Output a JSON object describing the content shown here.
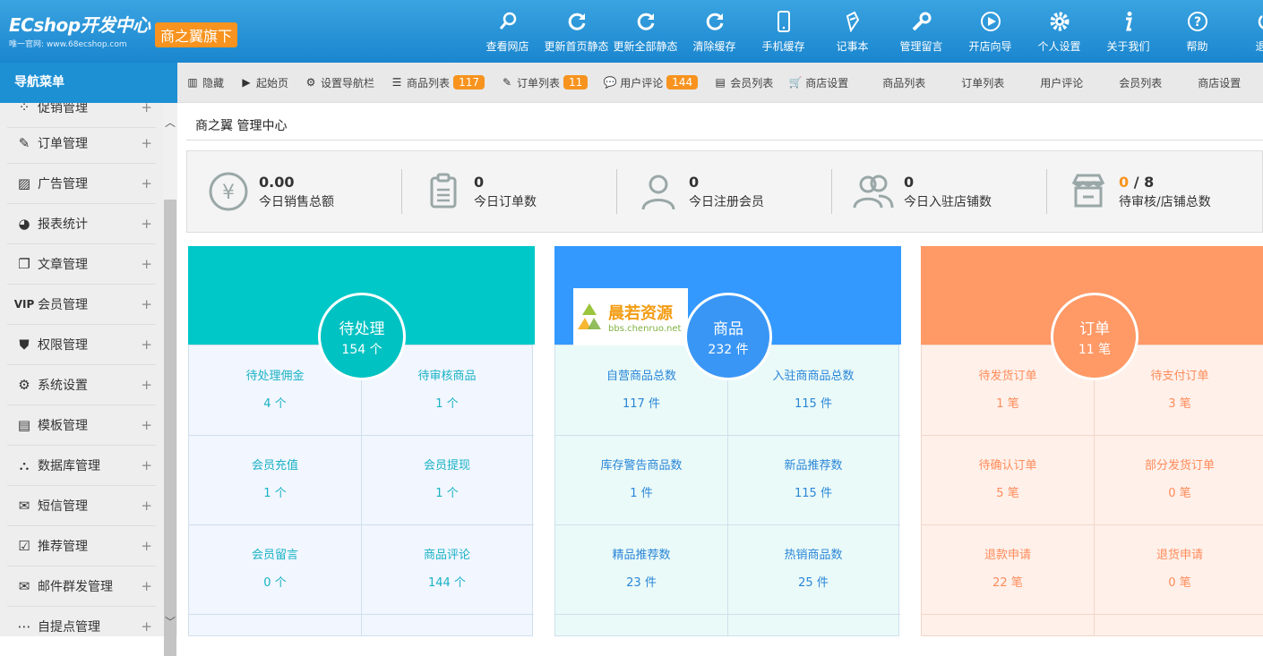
{
  "header": {
    "logo_text": "ECshop开发中心",
    "logo_sub": "唯一官网: www.68ecshop.com",
    "brand_badge": "商之翼旗下",
    "nav": [
      {
        "label": "查看网店",
        "icon": "search-icon"
      },
      {
        "label": "更新首页静态",
        "icon": "refresh-icon"
      },
      {
        "label": "更新全部静态",
        "icon": "refresh-icon"
      },
      {
        "label": "清除缓存",
        "icon": "refresh-icon"
      },
      {
        "label": "手机缓存",
        "icon": "phone-icon"
      },
      {
        "label": "记事本",
        "icon": "notebook-icon"
      },
      {
        "label": "管理留言",
        "icon": "wrench-icon"
      },
      {
        "label": "开店向导",
        "icon": "play-icon"
      },
      {
        "label": "个人设置",
        "icon": "gear-icon"
      },
      {
        "label": "关于我们",
        "icon": "info-icon"
      },
      {
        "label": "帮助",
        "icon": "help-icon"
      },
      {
        "label": "退出",
        "icon": "power-icon"
      }
    ]
  },
  "sidebar": {
    "title": "导航菜单",
    "items": [
      {
        "label": "促销管理",
        "icon": "promo-icon"
      },
      {
        "label": "订单管理",
        "icon": "order-icon"
      },
      {
        "label": "广告管理",
        "icon": "image-icon"
      },
      {
        "label": "报表统计",
        "icon": "pie-chart-icon"
      },
      {
        "label": "文章管理",
        "icon": "copy-icon"
      },
      {
        "label": "会员管理",
        "icon": "vip-icon"
      },
      {
        "label": "权限管理",
        "icon": "shield-icon"
      },
      {
        "label": "系统设置",
        "icon": "gears-icon"
      },
      {
        "label": "模板管理",
        "icon": "template-icon"
      },
      {
        "label": "数据库管理",
        "icon": "sitemap-icon"
      },
      {
        "label": "短信管理",
        "icon": "sms-icon"
      },
      {
        "label": "推荐管理",
        "icon": "checkbox-icon"
      },
      {
        "label": "邮件群发管理",
        "icon": "mail-icon"
      },
      {
        "label": "自提点管理",
        "icon": "more-icon"
      }
    ],
    "expand_symbol": "+"
  },
  "tabs": [
    {
      "label": "隐藏",
      "icon": "columns-icon"
    },
    {
      "label": "起始页",
      "icon": "play-circle-icon"
    },
    {
      "label": "设置导航栏",
      "icon": "settings-icon"
    },
    {
      "label": "商品列表",
      "icon": "list-icon",
      "badge": "117"
    },
    {
      "label": "订单列表",
      "icon": "order-list-icon",
      "badge": "11"
    },
    {
      "label": "用户评论",
      "icon": "comment-icon",
      "badge": "144"
    },
    {
      "label": "会员列表",
      "icon": "member-icon"
    },
    {
      "label": "商店设置",
      "icon": "shop-icon"
    }
  ],
  "plain_tabs": [
    "商品列表",
    "订单列表",
    "用户评论",
    "会员列表",
    "商店设置"
  ],
  "breadcrumb": "商之翼 管理中心",
  "stats": [
    {
      "value": "0.00",
      "label": "今日销售总额",
      "icon": "yen-icon"
    },
    {
      "value": "0",
      "label": "今日订单数",
      "icon": "clipboard-icon"
    },
    {
      "value": "0",
      "label": "今日注册会员",
      "icon": "user-icon"
    },
    {
      "value": "0",
      "label": "今日入驻店铺数",
      "icon": "users-icon"
    },
    {
      "value_highlight": "0",
      "value_rest": " / 8",
      "label": "待审核/店铺总数",
      "icon": "store-icon"
    }
  ],
  "cards": [
    {
      "title": "待处理",
      "count": "154 个",
      "cells": [
        {
          "label": "待处理佣金",
          "value": "4 个"
        },
        {
          "label": "待审核商品",
          "value": "1 个"
        },
        {
          "label": "会员充值",
          "value": "1 个"
        },
        {
          "label": "会员提现",
          "value": "1 个"
        },
        {
          "label": "会员留言",
          "value": "0 个"
        },
        {
          "label": "商品评论",
          "value": "144 个"
        }
      ]
    },
    {
      "title": "商品",
      "count": "232 件",
      "cells": [
        {
          "label": "自营商品总数",
          "value": "117 件"
        },
        {
          "label": "入驻商商品总数",
          "value": "115 件"
        },
        {
          "label": "库存警告商品数",
          "value": "1 件"
        },
        {
          "label": "新品推荐数",
          "value": "115 件"
        },
        {
          "label": "精品推荐数",
          "value": "23 件"
        },
        {
          "label": "热销商品数",
          "value": "25 件"
        }
      ]
    },
    {
      "title": "订单",
      "count": "11 笔",
      "cells": [
        {
          "label": "待发货订单",
          "value": "1 笔"
        },
        {
          "label": "待支付订单",
          "value": "3 笔"
        },
        {
          "label": "待确认订单",
          "value": "5 笔"
        },
        {
          "label": "部分发货订单",
          "value": "0 笔"
        },
        {
          "label": "退款申请",
          "value": "22 笔"
        },
        {
          "label": "退货申请",
          "value": "0 笔"
        }
      ]
    }
  ],
  "watermark": {
    "line1": "晨若资源",
    "line2": "bbs.chenruo.net"
  },
  "colors": {
    "header": "#1a86cf",
    "accent": "#f7931e",
    "teal": "#00c8c8",
    "blue": "#3399ff",
    "orange": "#ff9966"
  }
}
